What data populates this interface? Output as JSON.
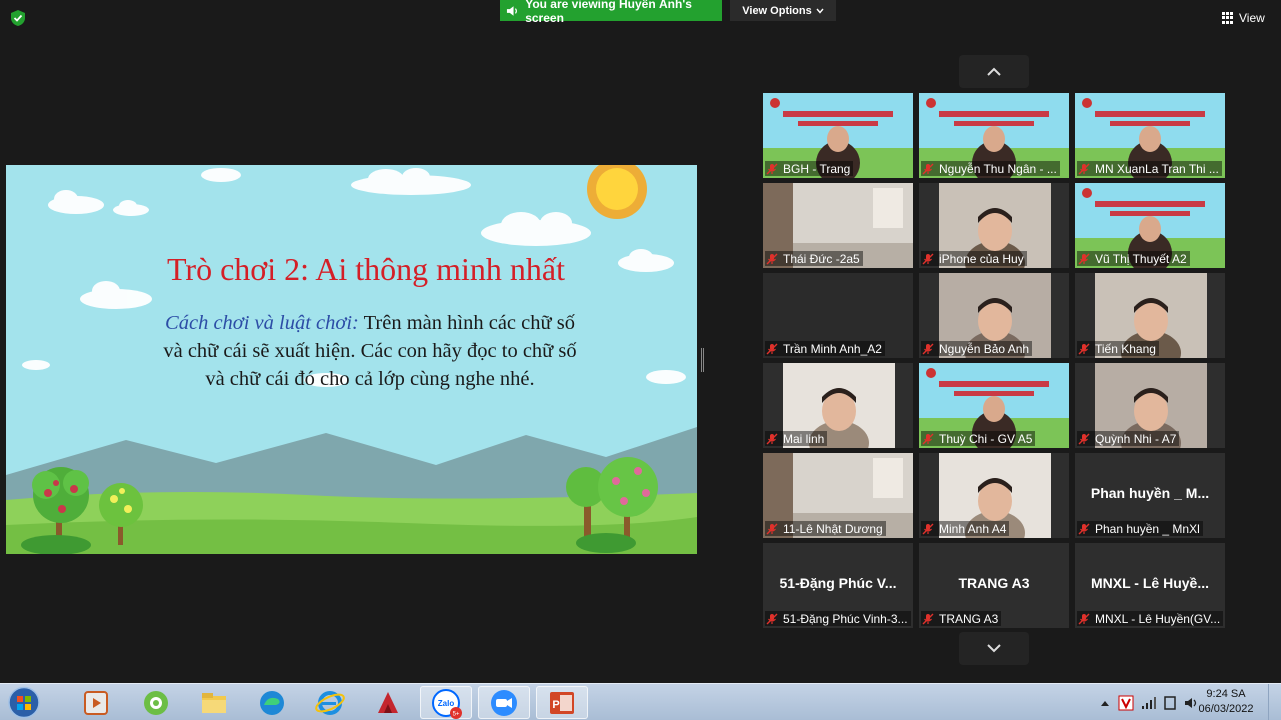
{
  "topbar": {
    "banner_text": "You are viewing Huyền Ánh's screen",
    "view_options_label": "View Options",
    "view_label": "View"
  },
  "slide": {
    "title": "Trò chơi 2: Ai thông minh nhất",
    "rules_label": "Cách chơi và luật chơi:",
    "line1": "Trên màn hình các chữ số",
    "line2": "và chữ cái sẽ xuất hiện. Các con hãy đọc to chữ số",
    "line3": "và chữ cái đó cho cả lớp cùng nghe nhé."
  },
  "participants": [
    {
      "label": "BGH - Trang",
      "content": "banner-video"
    },
    {
      "label": "Nguyễn Thu Ngân - ...",
      "content": "banner-video"
    },
    {
      "label": "MN XuanLa Tran Thi ...",
      "content": "banner-video"
    },
    {
      "label": "Thái Đức -2a5",
      "content": "room-video"
    },
    {
      "label": "iPhone của Huy",
      "content": "child-video"
    },
    {
      "label": "Vũ Thị Thuyết A2",
      "content": "banner-video"
    },
    {
      "label": "Trần Minh Anh_A2",
      "content": "empty-video"
    },
    {
      "label": "Nguyễn Bảo Anh",
      "content": "child-video"
    },
    {
      "label": "Tiến Khang",
      "content": "child-video"
    },
    {
      "label": "Mai linh",
      "content": "child-video"
    },
    {
      "label": "Thuỳ Chi - GV A5",
      "content": "banner-video"
    },
    {
      "label": "Quỳnh Nhi - A7",
      "content": "child-video"
    },
    {
      "label": "11-Lê Nhật Dương",
      "content": "room-video"
    },
    {
      "label": "Minh Anh A4",
      "content": "child-video"
    },
    {
      "label": "Phan huyền _ MnXl",
      "content": "name-only",
      "display_name": "Phan huyền _ M..."
    },
    {
      "label": "51-Đặng Phúc Vinh-3...",
      "content": "name-only",
      "display_name": "51-Đặng Phúc V..."
    },
    {
      "label": "TRANG A3",
      "content": "name-only",
      "display_name": "TRANG A3"
    },
    {
      "label": "MNXL - Lê Huyền(GV...",
      "content": "name-only",
      "display_name": "MNXL - Lê Huyề..."
    }
  ],
  "taskbar": {
    "apps": [
      "media-player-icon",
      "coccoc-browser-icon",
      "file-explorer-icon",
      "edge-icon",
      "internet-explorer-icon",
      "autocad-icon",
      "zalo-icon",
      "zoom-icon",
      "powerpoint-icon"
    ],
    "active_apps": [
      "zalo-icon",
      "zoom-icon",
      "powerpoint-icon"
    ],
    "zalo_label": "Zalo",
    "zalo_badge": "5+",
    "time": "9:24 SA",
    "date": "06/03/2022"
  },
  "colors": {
    "banner_green": "#23a12f",
    "slide_title_red": "#d41f27",
    "slide_rules_blue": "#2c4da6",
    "muted_mic_red": "#e0312b"
  }
}
